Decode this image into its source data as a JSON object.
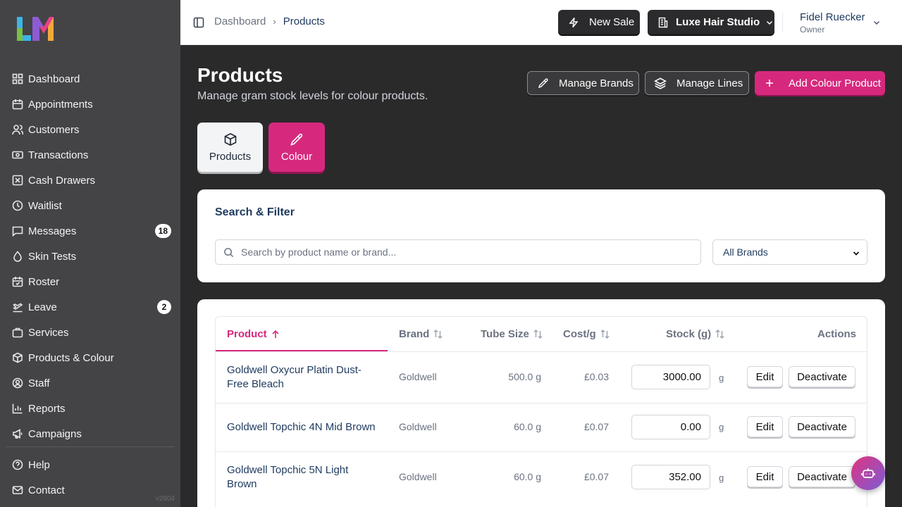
{
  "colors": {
    "accent": "#d6297e",
    "sidebar_bg": "#444446",
    "main_bg": "#2a2a2b",
    "heading_text": "#1e3a5f"
  },
  "sidebar": {
    "logo_icon": "lm-logo-icon",
    "items": [
      {
        "label": "Dashboard",
        "icon": "grid-icon"
      },
      {
        "label": "Appointments",
        "icon": "calendar-icon"
      },
      {
        "label": "Customers",
        "icon": "users-icon"
      },
      {
        "label": "Transactions",
        "icon": "banknote-icon"
      },
      {
        "label": "Cash Drawers",
        "icon": "x-box-icon"
      },
      {
        "label": "Waitlist",
        "icon": "clock-icon"
      },
      {
        "label": "Messages",
        "icon": "message-icon",
        "badge": "18"
      },
      {
        "label": "Skin Tests",
        "icon": "droplet-icon"
      },
      {
        "label": "Roster",
        "icon": "calendar-check-icon"
      },
      {
        "label": "Leave",
        "icon": "plane-icon",
        "badge": "2"
      },
      {
        "label": "Services",
        "icon": "briefcase-icon"
      },
      {
        "label": "Products & Colour",
        "icon": "box-icon"
      },
      {
        "label": "Staff",
        "icon": "user-circle-icon"
      },
      {
        "label": "Reports",
        "icon": "chart-icon"
      },
      {
        "label": "Campaigns",
        "icon": "megaphone-icon"
      }
    ],
    "bottom_items": [
      {
        "label": "Help",
        "icon": "help-icon"
      },
      {
        "label": "Contact",
        "icon": "mail-icon"
      }
    ],
    "version": "v2604"
  },
  "header": {
    "breadcrumb": [
      "Dashboard",
      "Products"
    ],
    "new_sale_label": "New Sale",
    "studio_label": "Luxe Hair Studio",
    "user_name": "Fidel Ruecker",
    "user_role": "Owner"
  },
  "page": {
    "title": "Products",
    "subtitle": "Manage gram stock levels for colour products.",
    "manage_brands_label": "Manage Brands",
    "manage_lines_label": "Manage Lines",
    "add_colour_label": "Add Colour Product",
    "tabs": [
      {
        "label": "Products",
        "icon": "box-icon"
      },
      {
        "label": "Colour",
        "icon": "pipette-icon"
      }
    ]
  },
  "filter": {
    "title": "Search & Filter",
    "search_placeholder": "Search by product name or brand...",
    "brand_selected": "All Brands"
  },
  "table": {
    "headers": {
      "product": "Product",
      "brand": "Brand",
      "tube": "Tube Size",
      "cost": "Cost/g",
      "stock": "Stock (g)",
      "actions": "Actions"
    },
    "unit": "g",
    "edit_label": "Edit",
    "deactivate_label": "Deactivate",
    "rows": [
      {
        "product": "Goldwell Oxycur Platin Dust-Free Bleach",
        "brand": "Goldwell",
        "tube": "500.0 g",
        "cost": "£0.03",
        "stock": "3000.00"
      },
      {
        "product": "Goldwell Topchic 4N Mid Brown",
        "brand": "Goldwell",
        "tube": "60.0 g",
        "cost": "£0.07",
        "stock": "0.00"
      },
      {
        "product": "Goldwell Topchic 5N Light Brown",
        "brand": "Goldwell",
        "tube": "60.0 g",
        "cost": "£0.07",
        "stock": "352.00"
      }
    ]
  },
  "assistant": {
    "icon": "bot-icon"
  }
}
